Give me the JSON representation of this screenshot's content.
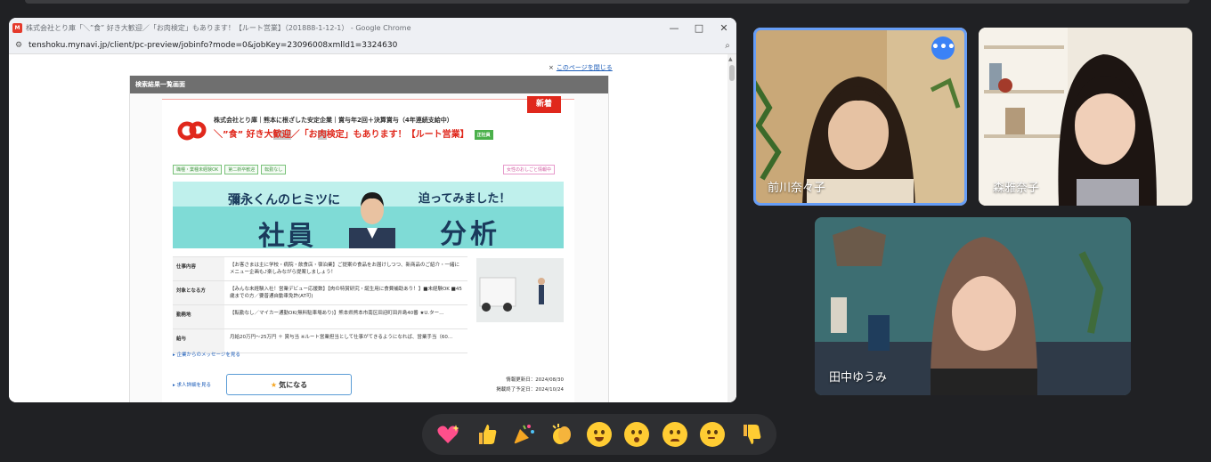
{
  "browser": {
    "title": "株式会社とり庫「＼”食” 好き大歓迎／「お肉検定」もあります！【ルート営業】（201888-1-12-1） - Google Chrome",
    "url": "tenshoku.mynavi.jp/client/pc-preview/jobinfo?mode=0&jobKey=23096008xmlld1=3324630",
    "app_icon": "mynavi",
    "window_buttons": [
      "—",
      "□",
      "✕"
    ]
  },
  "page": {
    "close_link": "このページを閉じる",
    "panel_header": "検索結果一覧画面",
    "new_badge": "新着",
    "company": "株式会社とり庫｜熊本に根ざした安定企業｜賞与年2回＋決算賞与（4年連続支給中）",
    "job_title_pre": "＼”食” 好き大",
    "job_title_hl1": "歓迎",
    "job_title_mid": "／「お",
    "job_title_hl2": "肉",
    "job_title_post": "検定」もあります！【ルート営業】",
    "employment_badge": "正社員",
    "tags": [
      "職種・業種未経験OK",
      "第二新卒歓迎",
      "転勤なし"
    ],
    "tag_right": "女性のおしごと情報中",
    "banner": {
      "line1": "彌永くんのヒミツに",
      "line2": "社員",
      "line3": "迫ってみました！",
      "line4": "分析"
    },
    "info_rows": [
      {
        "label": "仕事内容",
        "value": "【お客さまは主に学校・病院・飲食店・宿泊業】ご提案の食品をお届けしつつ、新商品のご紹介・一緒にメニュー企画も♪楽しみながら提案しましょう！"
      },
      {
        "label": "対象となる方",
        "value": "【みんな未経験入社！営業デビュー応援数】【肉の特賞研究・誕生用に食費補助あり！】■未経験OK ■45歳までの方／要普通自動車免許(AT可)"
      },
      {
        "label": "勤務地",
        "value": "【転勤なし／マイカー通勤OK(無料駐車場あり)】熊本県熊本市南区田迎町田井島40番 ★U.ター…"
      },
      {
        "label": "給与",
        "value": "月給20万円〜25万円 ＋ 賞与当 ※ルート営業担当として仕事がてきるようになれば、営業手当（60…"
      }
    ],
    "message_link": "▸ 企業からのメッセージを見る",
    "detail_link": "▸ 求人詳細を見る",
    "favorite_button": "気になる",
    "dates": [
      "情報更新日：2024/08/30",
      "掲載終了予定日：2024/10/24"
    ]
  },
  "participants": [
    {
      "name": "前川奈々子",
      "active": true,
      "more_button": "•••"
    },
    {
      "name": "森雅奈子",
      "active": false
    },
    {
      "name": "田中ゆうみ",
      "active": false
    }
  ],
  "reactions": [
    "sparkling-heart",
    "thumbs-up",
    "party-popper",
    "clapping-hands",
    "tears-of-joy",
    "surprised-face",
    "crying-face",
    "thinking-face",
    "thumbs-down"
  ],
  "colors": {
    "accent": "#669df6",
    "brand_red": "#e0281c",
    "background": "#202124"
  }
}
